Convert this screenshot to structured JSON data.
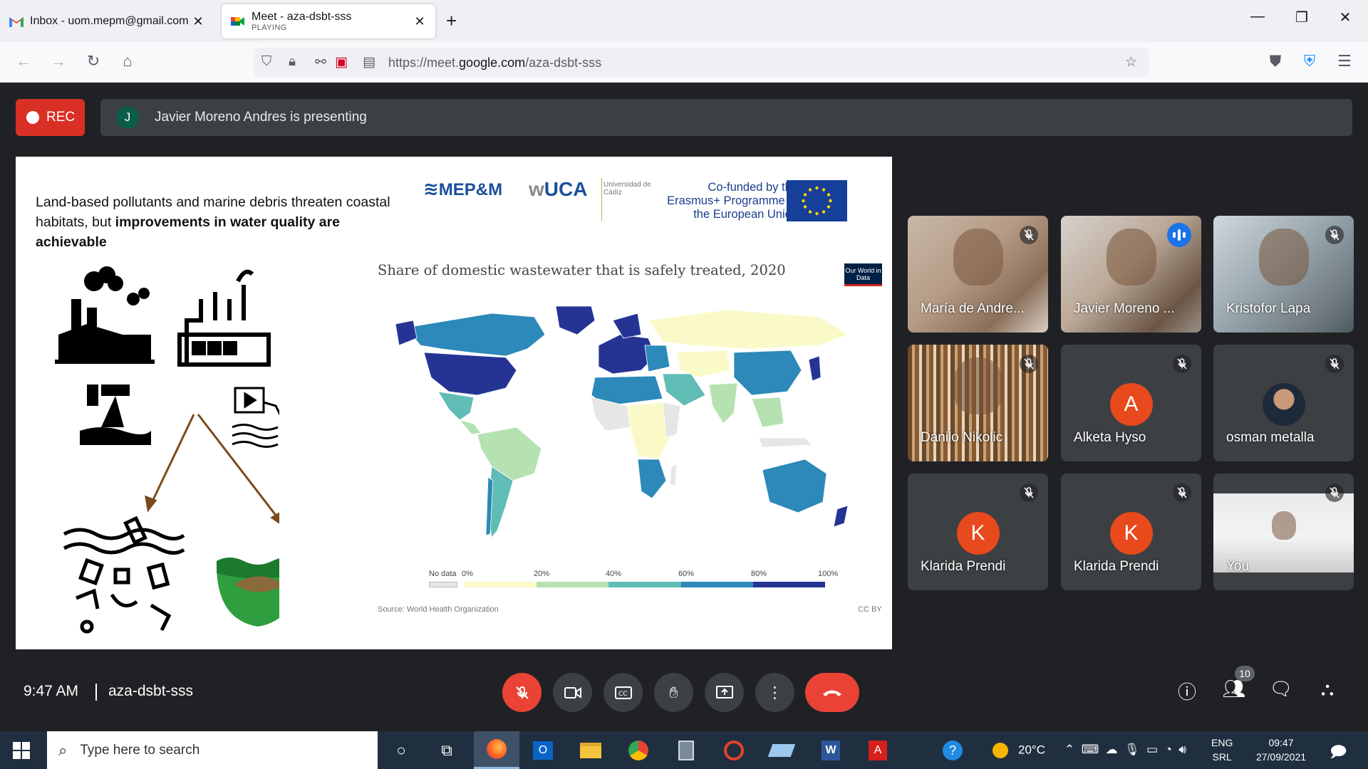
{
  "browser": {
    "tabs": [
      {
        "title": "Inbox - uom.mepm@gmail.com",
        "sub": "",
        "favicon": "gmail-icon"
      },
      {
        "title": "Meet - aza-dsbt-sss",
        "sub": "PLAYING",
        "favicon": "meet-icon"
      }
    ],
    "url_prefix": "https://meet.",
    "url_domain": "google.com",
    "url_path": "/aza-dsbt-sss"
  },
  "meet": {
    "rec_label": "REC",
    "presenter_initial": "J",
    "presenting_text": "Javier Moreno Andres is presenting",
    "time": "9:47 AM",
    "meeting_code": "aza-dsbt-sss",
    "participant_count": "10"
  },
  "slide": {
    "title_plain": "Land-based pollutants and marine debris threaten coastal habitats, but ",
    "title_bold": "improvements in water quality are achievable",
    "logo_mepm": "MEP&M",
    "logo_uca": "UCA",
    "logo_uca_sub": "Universidad de Cádiz",
    "eu_text": "Co-funded by the Erasmus+ Programme of the European Union",
    "map_title": "Share of domestic wastewater that is safely treated, 2020",
    "owid_badge": "Our World in Data",
    "legend_nodata": "No data",
    "legend_ticks": [
      "0%",
      "20%",
      "40%",
      "60%",
      "80%",
      "100%"
    ],
    "legend_colors": [
      "#fafac8",
      "#b5e2b0",
      "#5fbdb6",
      "#2c89b9",
      "#253494"
    ],
    "source": "Source: World Health Organization",
    "license": "CC BY"
  },
  "participants": [
    {
      "name": "María de Andre...",
      "muted": true,
      "speaking": false,
      "kind": "video"
    },
    {
      "name": "Javier Moreno ...",
      "muted": false,
      "speaking": true,
      "kind": "video"
    },
    {
      "name": "Kristofor Lapa",
      "muted": true,
      "speaking": false,
      "kind": "video"
    },
    {
      "name": "Danilo Nikolic",
      "muted": true,
      "speaking": false,
      "kind": "video"
    },
    {
      "name": "Alketa Hyso",
      "muted": true,
      "speaking": false,
      "kind": "letter",
      "letter": "A"
    },
    {
      "name": "osman metalla",
      "muted": true,
      "speaking": false,
      "kind": "photo"
    },
    {
      "name": "Klarida Prendi",
      "muted": true,
      "speaking": false,
      "kind": "letter",
      "letter": "K"
    },
    {
      "name": "Klarida Prendi",
      "muted": true,
      "speaking": false,
      "kind": "letter",
      "letter": "K"
    },
    {
      "name": "You",
      "muted": true,
      "speaking": false,
      "kind": "video"
    }
  ],
  "taskbar": {
    "search_placeholder": "Type here to search",
    "temperature": "20°C",
    "lang_top": "ENG",
    "lang_bottom": "SRL",
    "time": "09:47",
    "date": "27/09/2021"
  }
}
